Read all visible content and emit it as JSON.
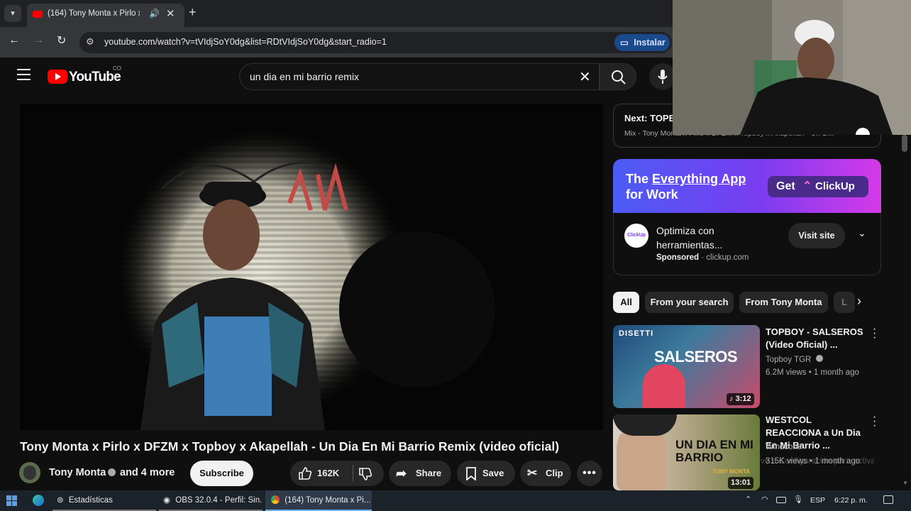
{
  "browser": {
    "tab_title": "(164) Tony Monta x Pirlo x D",
    "url": "youtube.com/watch?v=tVIdjSoY0dg&list=RDtVIdjSoY0dg&start_radio=1",
    "install_label": "Instalar"
  },
  "youtube": {
    "logo_text": "YouTube",
    "country_code": "CO",
    "search_value": "un dia en mi barrio remix"
  },
  "video": {
    "title": "Tony Monta x Pirlo x DFZM x Topboy x Akapellah - Un Dia En Mi Barrio Remix (video oficial)",
    "channel": "Tony Monta",
    "and_more": "and 4 more",
    "subscribe_label": "Subscribe",
    "likes": "162K",
    "share_label": "Share",
    "save_label": "Save",
    "clip_label": "Clip",
    "graffiti_text": "AM"
  },
  "next_card": {
    "label": "Next: TOPB",
    "subtitle": "Mix - Tony Monta x Pirlo x DFZM x Topboy x Akapellah - Un D..."
  },
  "ad": {
    "headline_prefix": "The ",
    "headline_highlight": "Everything App",
    "headline_line2": "for Work",
    "cta_get": "Get",
    "cta_brand": "ClickUp",
    "logo_text": "ClickUp",
    "description": "Optimiza con herramientas...",
    "sponsored_label": "Sponsored",
    "domain": "clickup.com",
    "visit_label": "Visit site"
  },
  "chips": [
    "All",
    "From your search",
    "From Tony Monta",
    "L"
  ],
  "recommendations": [
    {
      "title": "TOPBOY - SALSEROS (Video Oficial) ...",
      "channel": "Topboy TGR",
      "meta": "6.2M views • 1 month ago",
      "duration": "3:12",
      "thumb_text_top": "DISETTI",
      "thumb_text_main": "SALSEROS"
    },
    {
      "title": "WESTCOL REACCIONA a Un Dia En Mi Barrio ...",
      "channel": "Windcons",
      "meta": "315K views • 1 month ago",
      "duration": "13:01",
      "thumb_text_main": "UN DIA EN MI BARRIO",
      "thumb_text_sub": "TONY MONTA"
    }
  ],
  "watermark": "ve a Configuración para activar Windows.",
  "taskbar": {
    "items": [
      "Estadísticas",
      "OBS 32.0.4 - Perfil: Sin...",
      "(164) Tony Monta x Pi..."
    ],
    "language": "ESP",
    "time": "6:22 p. m."
  },
  "colors": {
    "youtube_red": "#ff0000",
    "ad_gradient_start": "#4b5cf5",
    "ad_gradient_end": "#d63ae8",
    "install_blue": "#1a4a8c"
  }
}
